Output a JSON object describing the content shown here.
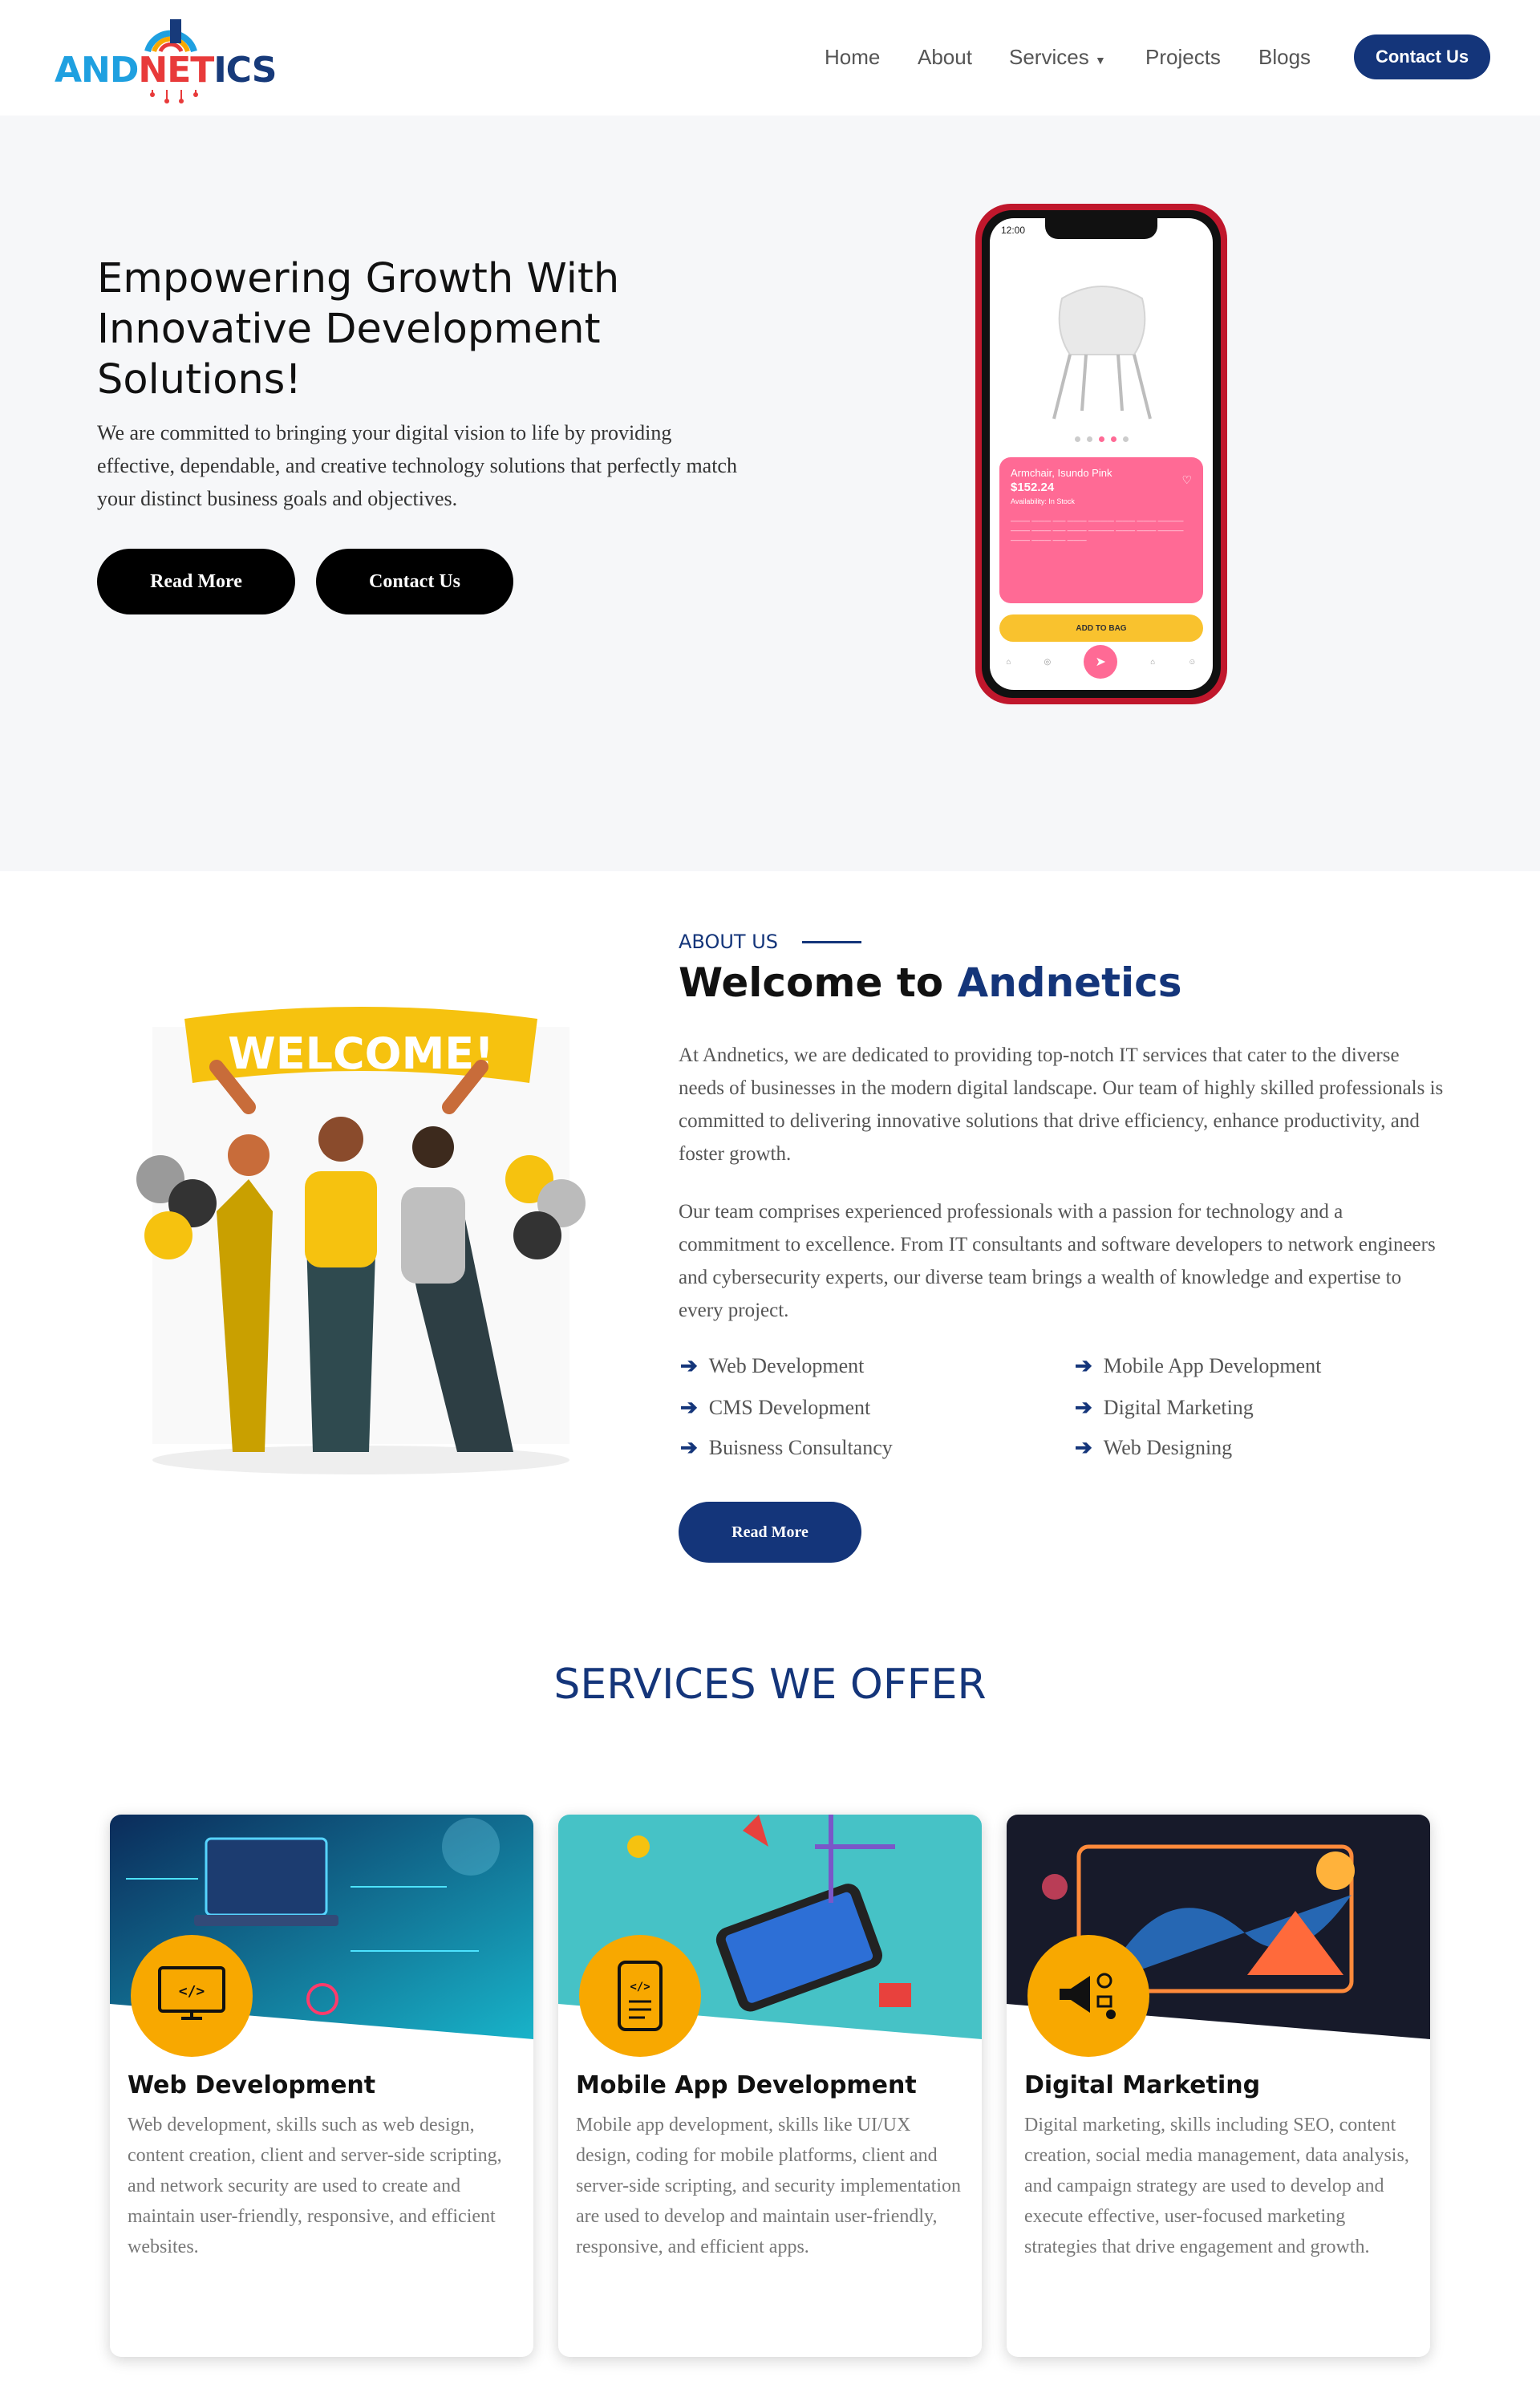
{
  "nav": {
    "logo_text": [
      "AND",
      "NET",
      "ICS"
    ],
    "links": [
      "Home",
      "About",
      "Services",
      "Projects",
      "Blogs"
    ],
    "cta": "Contact Us"
  },
  "hero": {
    "title": "Empowering Growth With Innovative Development Solutions!",
    "description": "We are committed to bringing your digital vision to life by providing effective, dependable, and creative technology solutions that perfectly match your distinct business goals and objectives.",
    "read_more": "Read More",
    "contact": "Contact Us",
    "phone": {
      "time": "12:00",
      "product_name": "Armchair, Isundo Pink",
      "price": "$152.24",
      "availability": "Availability: In Stock",
      "add_to_bag": "ADD TO BAG"
    }
  },
  "about": {
    "kicker": "ABOUT US",
    "title_plain": "Welcome to ",
    "title_brand": "Andnetics",
    "para1": "At Andnetics, we are dedicated to providing top-notch IT services that cater to the diverse needs of businesses in the modern digital landscape. Our team of highly skilled professionals is committed to delivering innovative solutions that drive efficiency, enhance productivity, and foster growth.",
    "para2": "Our team comprises experienced professionals with a passion for technology and a commitment to excellence. From IT consultants and software developers to network engineers and cybersecurity experts, our diverse team brings a wealth of knowledge and expertise to every project.",
    "features": [
      "Web Development",
      "Mobile App Development",
      "CMS Development",
      "Digital Marketing",
      "Buisness Consultancy",
      "Web Designing"
    ],
    "read_more": "Read More",
    "banner_text": "WELCOME!"
  },
  "services": {
    "title": "SERVICES WE OFFER",
    "cards": [
      {
        "title": "Web Development",
        "desc": "Web development, skills such as web design, content creation, client and server-side scripting, and network security are used to create and maintain user-friendly, responsive, and efficient websites."
      },
      {
        "title": "Mobile App Development",
        "desc": "Mobile app development, skills like UI/UX design, coding for mobile platforms, client and server-side scripting, and security implementation are used to develop and maintain user-friendly, responsive, and efficient apps."
      },
      {
        "title": "Digital Marketing",
        "desc": "Digital marketing, skills including SEO, content creation, social media management, data analysis, and campaign strategy are used to develop and execute effective, user-focused marketing strategies that drive engagement and growth."
      }
    ]
  },
  "colors": {
    "brand": "#14357a",
    "accent": "#f8a800",
    "pink": "#ff6a95",
    "hero_bg": "#f6f7f9"
  }
}
